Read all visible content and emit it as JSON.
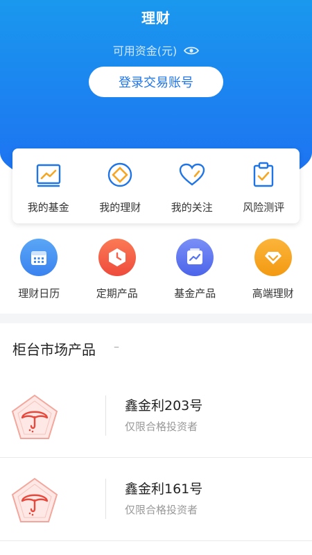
{
  "header": {
    "title": "理财",
    "funds_label": "可用资金(元)",
    "login_button": "登录交易账号"
  },
  "quick_actions": [
    {
      "label": "我的基金",
      "icon": "chart-frame-icon"
    },
    {
      "label": "我的理财",
      "icon": "diamond-circle-icon"
    },
    {
      "label": "我的关注",
      "icon": "heart-icon"
    },
    {
      "label": "风险测评",
      "icon": "clipboard-check-icon"
    }
  ],
  "product_shortcuts": [
    {
      "label": "理财日历",
      "icon": "calendar-icon",
      "color": "#3f8cf2"
    },
    {
      "label": "定期产品",
      "icon": "clock-hexagon-icon",
      "color": "#f5614a"
    },
    {
      "label": "基金产品",
      "icon": "trend-card-icon",
      "color": "#5674ef"
    },
    {
      "label": "高端理财",
      "icon": "diamond-icon",
      "color": "#f7a21b"
    }
  ],
  "section": {
    "title": "柜台市场产品",
    "dash": "–"
  },
  "products": [
    {
      "name": "鑫金利203号",
      "desc": "仅限合格投资者",
      "icon": "umbrella-pentagon-icon"
    },
    {
      "name": "鑫金利161号",
      "desc": "仅限合格投资者",
      "icon": "umbrella-pentagon-icon"
    }
  ],
  "colors": {
    "brand_blue": "#1c7ff0",
    "icon_blue": "#1f74e6",
    "badge_red": "#e8483c"
  }
}
